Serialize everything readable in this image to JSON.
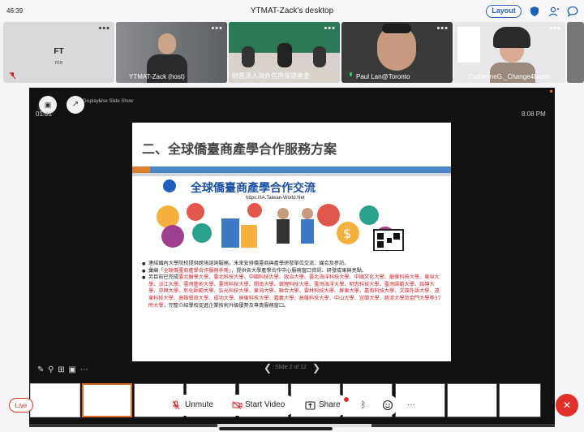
{
  "titlebar": {
    "clock": "46:39",
    "title": "YTMAT-Zack's desktop",
    "layout_label": "Layout"
  },
  "participants": [
    {
      "initials": "FT",
      "sub": "me",
      "name": ""
    },
    {
      "name": "YTMAT-Zack (host)"
    },
    {
      "name": "財團法人海外信用保證基金"
    },
    {
      "name": "Paul Lan@Toronto"
    },
    {
      "name": "CatherineG._Change4Better"
    }
  ],
  "presentation": {
    "timer": "01:01",
    "time": "8:08 PM",
    "slide_toolbar": {
      "a": "Displays",
      "b": "Use Slide Show"
    },
    "slide_counter": "Slide 2 of 12"
  },
  "slide": {
    "title": "二、全球僑臺商產學合作服務方案",
    "banner": "全球僑臺商產學合作交流",
    "url": "https://IA.Taiwan-World.Net",
    "bullet1": "連結國內大學院校提供跨境諮詢服務，未來安排僑臺商與產學研發單位交流、媒合及參訪。",
    "bullet2_a": "彙編「",
    "bullet2_red": "全球僑臺商產學合作服務手冊",
    "bullet2_b": "」，提供各大學產學合作中心服務窗口資訊、研發成果與亮點。",
    "bullet3_a": "另目前已完成",
    "bullet3_red": "臺北醫學大學、臺北科技大學、中國科技大學、政治大學、臺北海洋科技大學、中國文化大學、龍華科技大學、東吳大學、淡江大學、臺灣藝術大學、臺灣科技大學、開南大學、致理科技大學、臺灣海洋大學、明志科技大學、臺灣師範大學、銘傳大學、中興大學、彰化師範大學、弘光科技大學、東海大學、聯合大學、雲林科技大學、屏東大學、嘉南科技大學、文藻外語大學、遠東科技大學、高雄餐旅大學、成功大學、屏東科技大學、嘉義大學、高雄科技大學、中山大學、宜蘭大學、慈濟大學及金門大學等37所大學",
    "bullet3_b": "，完整介紹學校促進企業技術升級優勢及專責服務窗口。"
  },
  "controls": {
    "live": "Live",
    "unmute": "Unmute",
    "start_video": "Start Video",
    "share": "Share"
  },
  "colors": {
    "accent": "#1f5fbf",
    "end": "#e0302a",
    "stage": "#111111"
  }
}
